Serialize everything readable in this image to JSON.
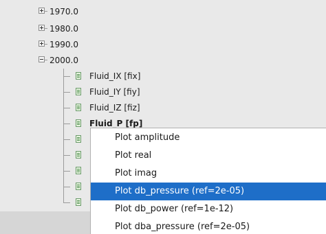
{
  "tree": {
    "years": [
      {
        "label": "1970.0",
        "expanded": false
      },
      {
        "label": "1980.0",
        "expanded": false
      },
      {
        "label": "1990.0",
        "expanded": false
      },
      {
        "label": "2000.0",
        "expanded": true
      }
    ],
    "leaves": [
      {
        "label": "Fluid_IX  [fix]",
        "bold": false
      },
      {
        "label": "Fluid_IY  [fiy]",
        "bold": false
      },
      {
        "label": "Fluid_IZ  [fiz]",
        "bold": false
      },
      {
        "label": "Fluid_P  [fp]",
        "bold": true
      },
      {
        "label": "",
        "bold": false
      },
      {
        "label": "",
        "bold": false
      },
      {
        "label": "",
        "bold": false
      },
      {
        "label": "",
        "bold": false
      },
      {
        "label": "",
        "bold": false
      }
    ]
  },
  "context_menu": {
    "items": [
      {
        "label": "Plot amplitude",
        "selected": false
      },
      {
        "label": "Plot real",
        "selected": false
      },
      {
        "label": "Plot imag",
        "selected": false
      },
      {
        "label": "Plot db_pressure (ref=2e-05)",
        "selected": true
      },
      {
        "label": "Plot db_power (ref=1e-12)",
        "selected": false
      },
      {
        "label": "Plot dba_pressure (ref=2e-05)",
        "selected": false
      }
    ]
  },
  "colors": {
    "panel_bg": "#e9e9e9",
    "menu_bg": "#ffffff",
    "selection": "#1e6ec8",
    "leaf_icon": "#4a8a4a"
  },
  "icons": {
    "expander_collapsed": "plus-box-icon",
    "expander_expanded": "minus-box-icon",
    "leaf": "document-leaf-icon"
  }
}
